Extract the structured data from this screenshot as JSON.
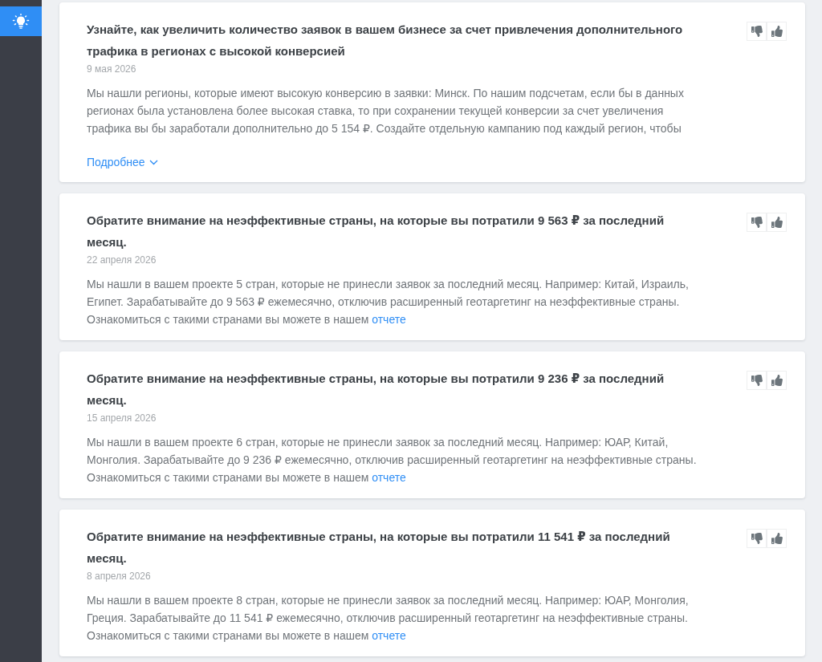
{
  "sidebar": {
    "items": [
      {
        "selected": true
      }
    ]
  },
  "recommendations": [
    {
      "title": "Узнайте, как увеличить количество заявок в вашем бизнесе за счет привлечения дополнительного трафика в регионах с высокой конверсией",
      "date": "9 мая 2026",
      "text": "Мы нашли регионы, которые имеют высокую конверсию в заявки: Минск. По нашим подсчетам, если бы в данных регионах была установлена более высокая ставка, то при сохранении текущей конверсии за счет увеличения трафика вы бы заработали дополнительно до 5 154 ₽. Создайте отдельную кампанию под каждый регион, чтобы",
      "more": {
        "label": "Подробнее",
        "expanded": false
      }
    },
    {
      "title": "Обратите внимание на неэффективные страны, на которые вы потратили 9 563 ₽ за последний месяц.",
      "date": "22 апреля 2026",
      "text": "Мы нашли в вашем проекте 5 стран, которые не принесли заявок за последний месяц. Например: Китай, Израиль, Египет. Зарабатывайте до 9 563 ₽ ежемесячно, отключив расширенный геотаргетинг на неэффективные страны. Ознакомиться с такими странами вы можете в нашем",
      "link": "отчете"
    },
    {
      "title": "Обратите внимание на неэффективные страны, на которые вы потратили 9 236 ₽ за последний месяц.",
      "date": "15 апреля 2026",
      "text": "Мы нашли в вашем проекте 6 стран, которые не принесли заявок за последний месяц. Например: ЮАР, Китай, Монголия. Зарабатывайте до 9 236 ₽ ежемесячно, отключив расширенный геотаргетинг на неэффективные страны. Ознакомиться с такими странами вы можете в нашем",
      "link": "отчете"
    },
    {
      "title": "Обратите внимание на неэффективные страны, на которые вы потратили 11 541 ₽ за последний месяц.",
      "date": "8 апреля 2026",
      "text": "Мы нашли в вашем проекте 8 стран, которые не принесли заявок за последний месяц. Например: ЮАР, Монголия, Греция. Зарабатывайте до 11 541 ₽ ежемесячно, отключив расширенный геотаргетинг на неэффективные страны. Ознакомиться с такими странами вы можете в нашем",
      "link": "отчете"
    }
  ]
}
